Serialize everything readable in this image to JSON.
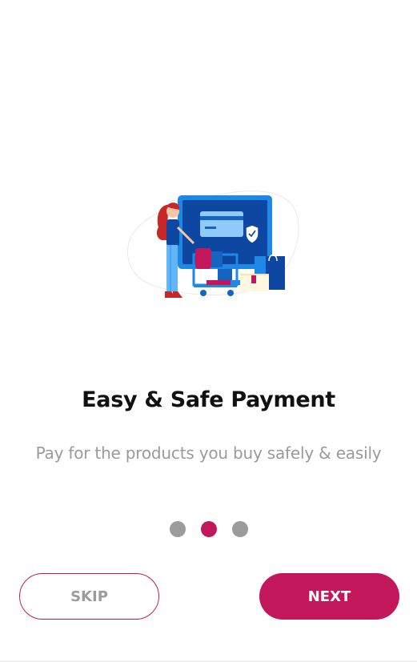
{
  "onboarding": {
    "title": "Easy & Safe Payment",
    "subtitle": "Pay for the products you buy safely & easily",
    "illustration_icon": "online-payment-illustration",
    "pagination": {
      "total": 3,
      "active_index": 1
    }
  },
  "actions": {
    "skip_label": "SKIP",
    "next_label": "NEXT"
  },
  "colors": {
    "accent": "#c2185b",
    "dot_inactive": "#9b9b9b",
    "title": "#111111",
    "subtitle": "#9a9a9a"
  }
}
